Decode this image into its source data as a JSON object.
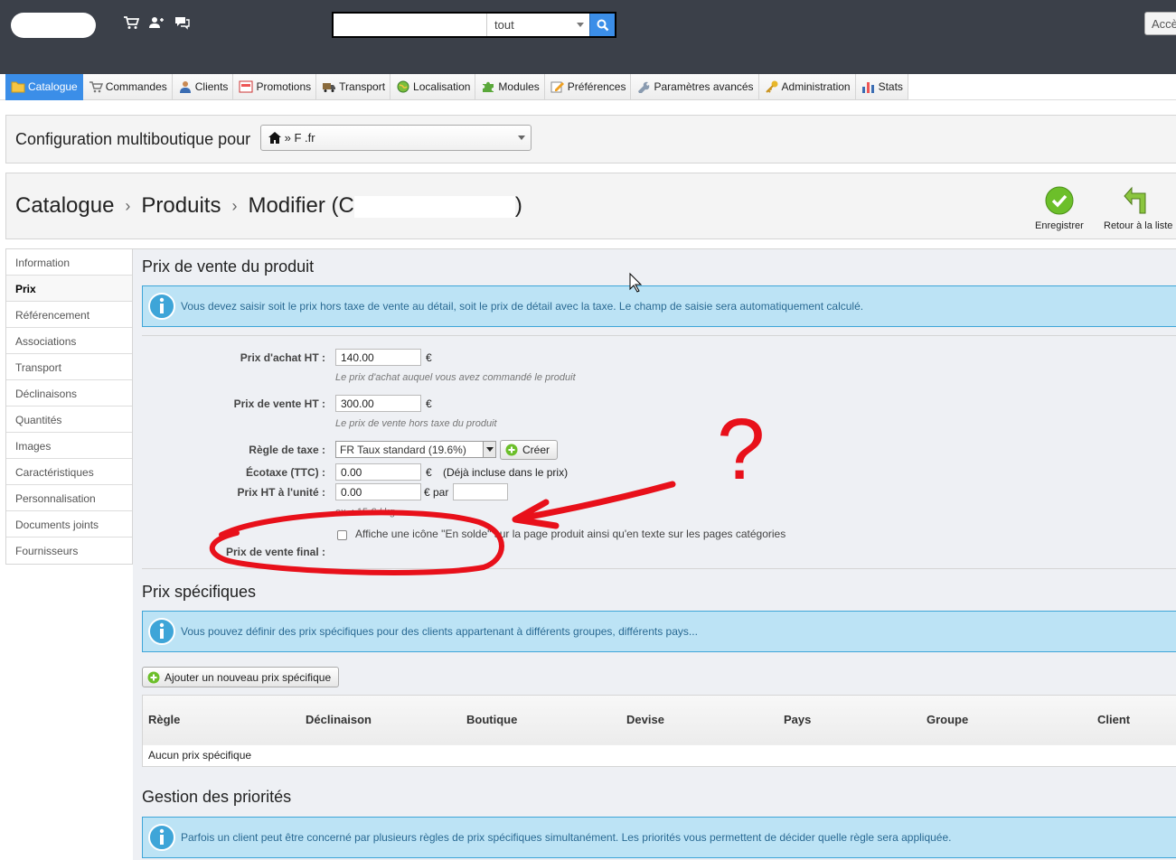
{
  "header": {
    "search": {
      "value": "",
      "scope": "tout"
    },
    "access_button": "Accè"
  },
  "nav": {
    "tabs": [
      {
        "label": "Catalogue",
        "icon": "folder-icon"
      },
      {
        "label": "Commandes",
        "icon": "cart-icon"
      },
      {
        "label": "Clients",
        "icon": "customer-icon"
      },
      {
        "label": "Promotions",
        "icon": "promotion-icon"
      },
      {
        "label": "Transport",
        "icon": "truck-icon"
      },
      {
        "label": "Localisation",
        "icon": "globe-icon"
      },
      {
        "label": "Modules",
        "icon": "puzzle-icon"
      },
      {
        "label": "Préférences",
        "icon": "preferences-icon"
      },
      {
        "label": "Paramètres avancés",
        "icon": "wrench-icon"
      },
      {
        "label": "Administration",
        "icon": "key-icon"
      },
      {
        "label": "Stats",
        "icon": "stats-icon"
      }
    ],
    "active": "Catalogue"
  },
  "multistore": {
    "label": "Configuration multiboutique pour",
    "selected": "» F         .fr"
  },
  "breadcrumb": {
    "parts": [
      "Catalogue",
      "Produits",
      "Modifier (C"
    ],
    "suffix": ")"
  },
  "toolbar": {
    "save": "Enregistrer",
    "back": "Retour à la liste"
  },
  "sidebar": {
    "items": [
      "Information",
      "Prix",
      "Référencement",
      "Associations",
      "Transport",
      "Déclinaisons",
      "Quantités",
      "Images",
      "Caractéristiques",
      "Personnalisation",
      "Documents joints",
      "Fournisseurs"
    ],
    "active": "Prix"
  },
  "pricing": {
    "title": "Prix de vente du produit",
    "info": "Vous devez saisir soit le prix hors taxe de vente au détail, soit le prix de détail avec la taxe. Le champ de saisie sera automatiquement calculé.",
    "purchase_label": "Prix d'achat HT :",
    "purchase_value": "140.00",
    "purchase_hint": "Le prix d'achat auquel vous avez commandé le produit",
    "sale_label": "Prix de vente HT :",
    "sale_value": "300.00",
    "sale_hint": "Le prix de vente hors taxe du produit",
    "tax_label": "Règle de taxe :",
    "tax_value": "FR Taux standard (19.6%)",
    "create_button": "Créer",
    "ecotax_label": "Écotaxe (TTC) :",
    "ecotax_value": "0.00",
    "ecotax_note": "(Déjà incluse dans le prix)",
    "unit_label": "Prix HT à l'unité :",
    "unit_value": "0.00",
    "unit_per": "€ par",
    "unit_hint": "ex. : 15 € / kg",
    "currency": "€",
    "onsale_label": "Affiche une icône \"En solde\" sur la page produit ainsi qu'en texte sur les pages catégories",
    "final_label": "Prix de vente final :"
  },
  "specific": {
    "title": "Prix spécifiques",
    "info": "Vous pouvez définir des prix spécifiques pour des clients appartenant à différents groupes, différents pays...",
    "add_button": "Ajouter un nouveau prix spécifique",
    "columns": [
      "Règle",
      "Déclinaison",
      "Boutique",
      "Devise",
      "Pays",
      "Groupe",
      "Client"
    ],
    "empty": "Aucun prix spécifique"
  },
  "priorities": {
    "title": "Gestion des priorités",
    "info": "Parfois un client peut être concerné par plusieurs règles de prix spécifiques simultanément. Les priorités vous permettent de décider quelle règle sera appliquée."
  },
  "annotation": {
    "mark": "?"
  },
  "colors": {
    "accent": "#3b8ee8",
    "header": "#3b4049",
    "info_bg": "#bce3f5",
    "annotation": "#e8101a"
  }
}
